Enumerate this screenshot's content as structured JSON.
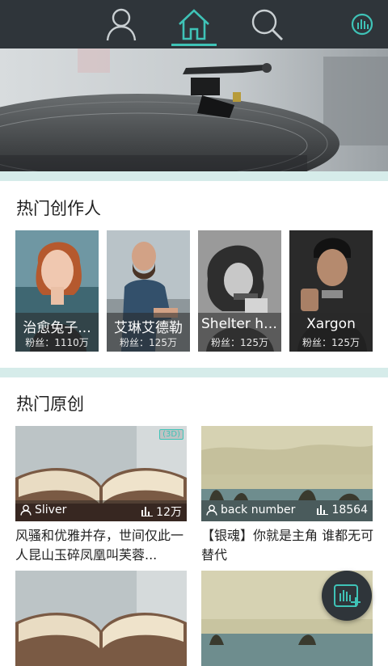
{
  "nav": {
    "items": [
      {
        "icon": "user-icon",
        "active": false
      },
      {
        "icon": "home-icon",
        "active": true
      },
      {
        "icon": "search-icon",
        "active": false
      },
      {
        "icon": "audio-stats-icon",
        "active": false
      }
    ],
    "accent_color": "#3fc3b7",
    "bar_color": "#2f353a"
  },
  "sections": {
    "creators_title": "热门创作人",
    "originals_title": "热门原创"
  },
  "creators": [
    {
      "name": "治愈兔子...",
      "fans": "粉丝：1110万"
    },
    {
      "name": "艾琳艾德勒",
      "fans": "粉丝：125万"
    },
    {
      "name": "Shelter ho...",
      "fans": "粉丝：125万"
    },
    {
      "name": "Xargon",
      "fans": "粉丝：125万"
    }
  ],
  "originals": [
    {
      "badge": "(3D)",
      "author": "Sliver",
      "plays": "12万",
      "title": "风骚和优雅并存，世间仅此一人昆山玉碎凤凰叫芙蓉..."
    },
    {
      "badge": "",
      "author": "back number",
      "plays": "18564",
      "title": "【银魂】你就是主角 谁都无可替代"
    },
    {
      "badge": "",
      "author": "",
      "plays": "",
      "title": ""
    },
    {
      "badge": "",
      "author": "",
      "plays": "",
      "title": ""
    }
  ],
  "fab": {
    "icon": "add-audio-icon"
  }
}
